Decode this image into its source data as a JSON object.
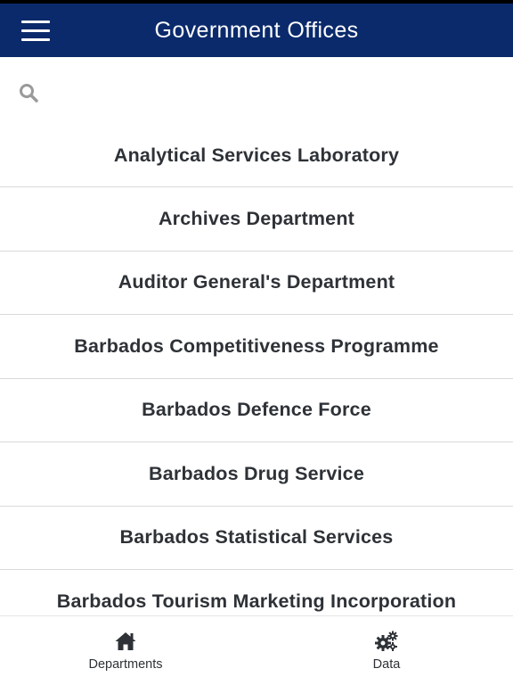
{
  "header": {
    "title": "Government Offices",
    "menu_icon": "hamburger-menu-icon"
  },
  "search": {
    "icon": "search-icon",
    "placeholder": "",
    "value": ""
  },
  "departments": [
    "Analytical Services Laboratory",
    "Archives Department",
    "Auditor General's Department",
    "Barbados Competitiveness Programme",
    "Barbados Defence Force",
    "Barbados Drug Service",
    "Barbados Statistical Services",
    "Barbados Tourism Marketing Incorporation"
  ],
  "bottom_nav": {
    "tabs": [
      {
        "label": "Departments",
        "icon": "home-icon"
      },
      {
        "label": "Data",
        "icon": "gears-icon"
      }
    ]
  },
  "colors": {
    "header_bg": "#0b2a6b",
    "header_text": "#ffffff",
    "item_text": "#2e3237",
    "divider": "#d9d9d9",
    "search_icon": "#9a9a9a"
  }
}
